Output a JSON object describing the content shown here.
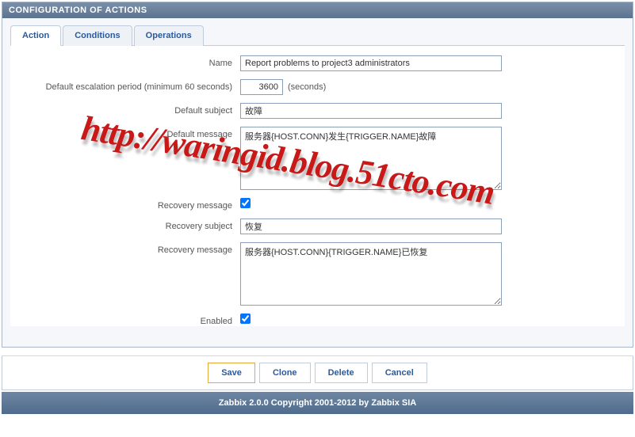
{
  "header": {
    "title": "CONFIGURATION OF ACTIONS"
  },
  "tabs": {
    "action": "Action",
    "conditions": "Conditions",
    "operations": "Operations"
  },
  "form": {
    "labels": {
      "name": "Name",
      "escalation": "Default escalation period (minimum 60 seconds)",
      "default_subject": "Default subject",
      "default_message": "Default message",
      "recovery_message": "Recovery message",
      "recovery_subject": "Recovery subject",
      "recovery_message2": "Recovery message",
      "enabled": "Enabled"
    },
    "values": {
      "name": "Report problems to project3 administrators",
      "escalation": "3600",
      "seconds_txt": "(seconds)",
      "default_subject": "故障",
      "default_message": "服务器{HOST.CONN}发生{TRIGGER.NAME}故障",
      "recovery_checked": true,
      "recovery_subject": "恢复",
      "recovery_message": "服务器{HOST.CONN}{TRIGGER.NAME}已恢复",
      "enabled_checked": true
    }
  },
  "buttons": {
    "save": "Save",
    "clone": "Clone",
    "delete": "Delete",
    "cancel": "Cancel"
  },
  "footer": {
    "text": "Zabbix 2.0.0 Copyright 2001-2012 by Zabbix SIA"
  },
  "watermark": "http://waringid.blog.51cto.com"
}
